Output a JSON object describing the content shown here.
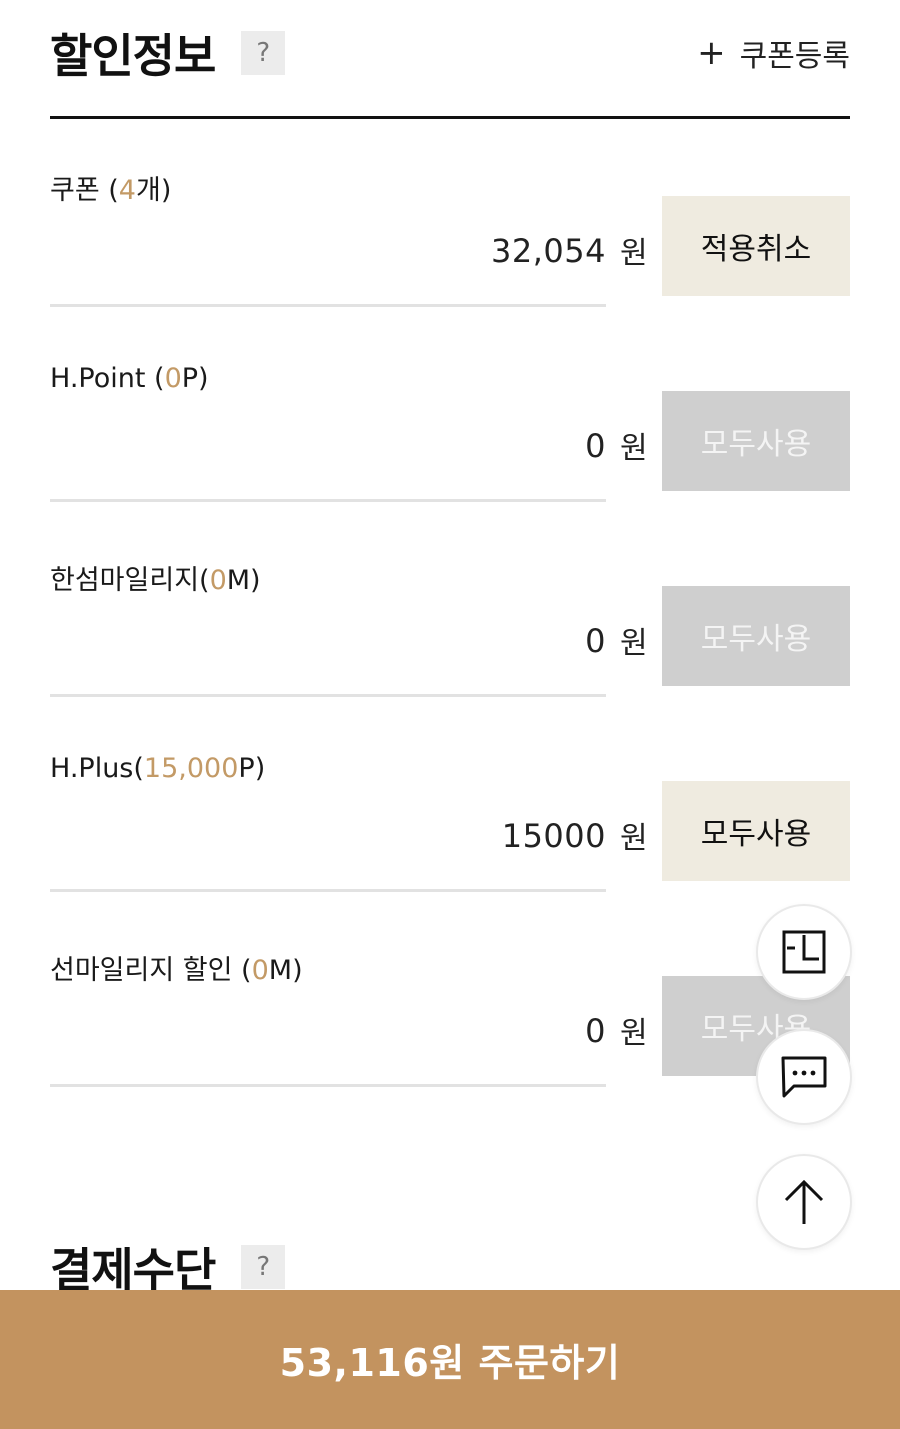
{
  "discount_section": {
    "title": "할인정보",
    "help": "?",
    "coupon_register_plus": "+",
    "coupon_register_label": "쿠폰등록"
  },
  "rows": [
    {
      "label_prefix": "쿠폰 (",
      "label_accent": "4",
      "label_suffix": "개)",
      "amount": "32,054",
      "unit": "원",
      "button": "적용취소",
      "button_state": "active"
    },
    {
      "label_prefix": "H.Point (",
      "label_accent": "0",
      "label_suffix": "P)",
      "amount": "0",
      "unit": "원",
      "button": "모두사용",
      "button_state": "disabled"
    },
    {
      "label_prefix": "한섬마일리지(",
      "label_accent": "0",
      "label_suffix": "M)",
      "amount": "0",
      "unit": "원",
      "button": "모두사용",
      "button_state": "disabled"
    },
    {
      "label_prefix": "H.Plus(",
      "label_accent": "15,000",
      "label_suffix": "P)",
      "amount": "15000",
      "unit": "원",
      "button": "모두사용",
      "button_state": "active"
    },
    {
      "label_prefix": "선마일리지 할인 (",
      "label_accent": "0",
      "label_suffix": "M)",
      "amount": "0",
      "unit": "원",
      "button": "모두사용",
      "button_state": "disabled"
    }
  ],
  "payment_section": {
    "title": "결제수단",
    "help": "?"
  },
  "floating_buttons": {
    "recent_icon": "recent-view-icon",
    "chat_icon": "chat-bubble-icon",
    "top_icon": "arrow-up-icon"
  },
  "order_bar": {
    "label": "53,116원 주문하기"
  },
  "colors": {
    "accent": "#c39a66",
    "order_bar": "#c3935f",
    "active_button": "#efebe0",
    "disabled_button": "#cfcfcf"
  }
}
